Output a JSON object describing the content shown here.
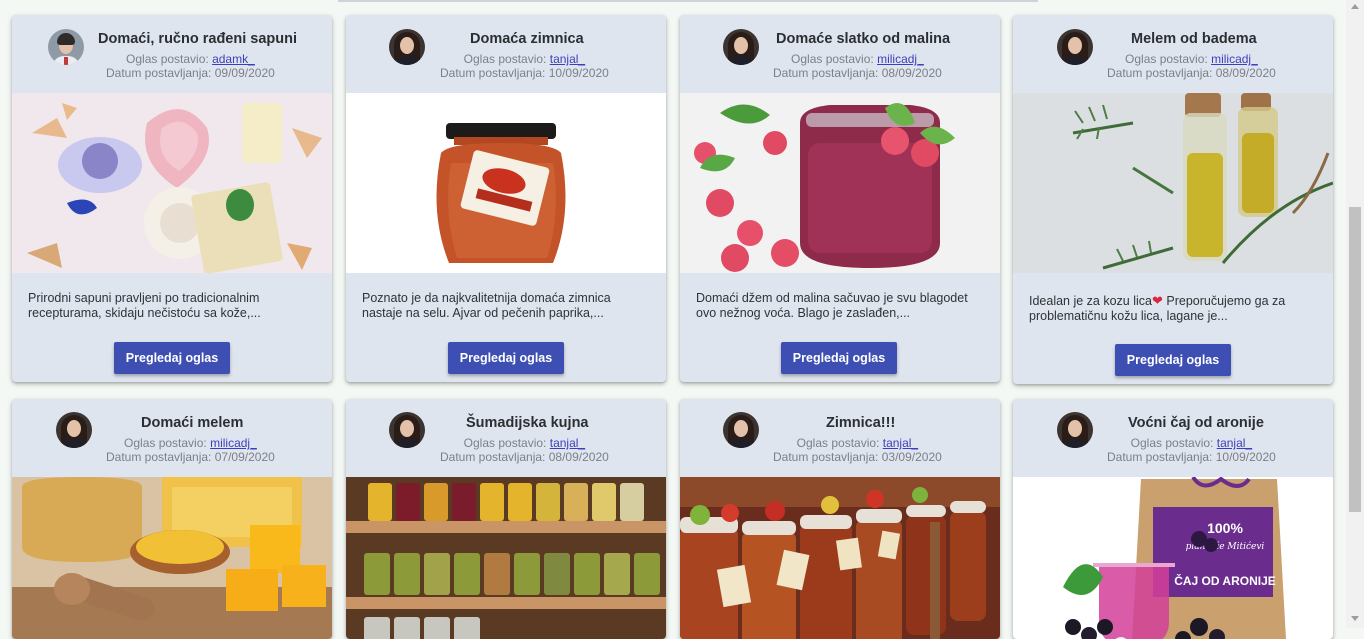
{
  "listings": [
    {
      "title": "Domaći, ručno rađeni sapuni",
      "posted_by_label": "Oglas postavio:",
      "author": "adamk_",
      "date_label": "Datum postavljanja:",
      "date": "09/09/2020",
      "description": "Prirodni sapuni pravljeni po tradicionalnim recepturama, skidaju nečistoću sa kože,...",
      "button_label": "Pregledaj oglas",
      "image_subject": "handmade-soaps"
    },
    {
      "title": "Domaća zimnica",
      "posted_by_label": "Oglas postavio:",
      "author": "tanjal_",
      "date_label": "Datum postavljanja:",
      "date": "10/09/2020",
      "description": "Poznato je da najkvalitetnija domaća zimnica nastaje na selu. Ajvar od pečenih paprika,...",
      "button_label": "Pregledaj oglas",
      "image_subject": "ajvar-jar"
    },
    {
      "title": "Domaće slatko od malina",
      "posted_by_label": "Oglas postavio:",
      "author": "milicadj_",
      "date_label": "Datum postavljanja:",
      "date": "08/09/2020",
      "description": "Domaći džem od malina sačuvao je svu blagodet ovo nežnog voća. Blago je zaslađen,...",
      "button_label": "Pregledaj oglas",
      "image_subject": "raspberry-jam"
    },
    {
      "title": "Melem od badema",
      "posted_by_label": "Oglas postavio:",
      "author": "milicadj_",
      "date_label": "Datum postavljanja:",
      "date": "08/09/2020",
      "description": "Idealan je za kozu lica",
      "description_tail": " Preporučujemo ga za problematičnu kožu lica, lagane je...",
      "button_label": "Pregledaj oglas",
      "image_subject": "almond-oil-bottles"
    },
    {
      "title": "Domaći melem",
      "posted_by_label": "Oglas postavio:",
      "author": "milicadj_",
      "date_label": "Datum postavljanja:",
      "date": "07/09/2020",
      "image_subject": "honey-balm"
    },
    {
      "title": "Šumadijska kujna",
      "posted_by_label": "Oglas postavio:",
      "author": "tanjal_",
      "date_label": "Datum postavljanja:",
      "date": "08/09/2020",
      "image_subject": "jar-shelves"
    },
    {
      "title": "Zimnica!!!",
      "posted_by_label": "Oglas postavio:",
      "author": "tanjal_",
      "date_label": "Datum postavljanja:",
      "date": "03/09/2020",
      "image_subject": "market-jars"
    },
    {
      "title": "Voćni čaj od aronije",
      "posted_by_label": "Oglas postavio:",
      "author": "tanjal_",
      "date_label": "Datum postavljanja:",
      "date": "10/09/2020",
      "image_subject": "aronia-tea",
      "package_text_top": "100%",
      "package_text_brand": "plantaže Mitićevi",
      "package_text_name": "ČAJ OD ARONIJE"
    }
  ],
  "colors": {
    "card_bg": "#dfe5ee",
    "button_bg": "#3e4fb3",
    "link": "#3b3fbf"
  }
}
